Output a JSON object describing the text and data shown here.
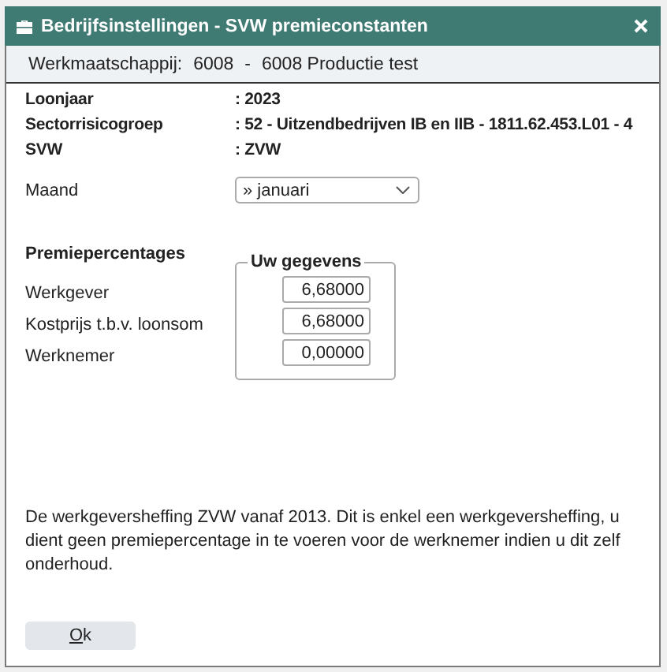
{
  "window": {
    "title": "Bedrijfsinstellingen - SVW premieconstanten"
  },
  "company": {
    "label": "Werkmaatschappij:",
    "code": "6008",
    "separator": "-",
    "name": "6008 Productie test"
  },
  "info": [
    {
      "label": "Loonjaar",
      "value": ": 2023"
    },
    {
      "label": "Sectorrisicogroep",
      "value": ": 52 - Uitzendbedrijven IB en IIB - 1811.62.453.L01 - 4"
    },
    {
      "label": "SVW",
      "value": ": ZVW"
    }
  ],
  "month": {
    "label": "Maand",
    "value": "» januari"
  },
  "premiums": {
    "label": "Premiepercentages",
    "legend": "Uw gegevens",
    "rows": [
      {
        "label": "Werkgever",
        "value": "6,68000"
      },
      {
        "label": "Kostprijs t.b.v. loonsom",
        "value": "6,68000"
      },
      {
        "label": "Werknemer",
        "value": "0,00000"
      }
    ]
  },
  "note": "De werkgeversheffing ZVW vanaf 2013. Dit is enkel een werkgeversheffing, u dient geen premiepercentage in te voeren voor de werknemer indien u dit zelf onderhoud.",
  "buttons": [
    "Ok"
  ]
}
